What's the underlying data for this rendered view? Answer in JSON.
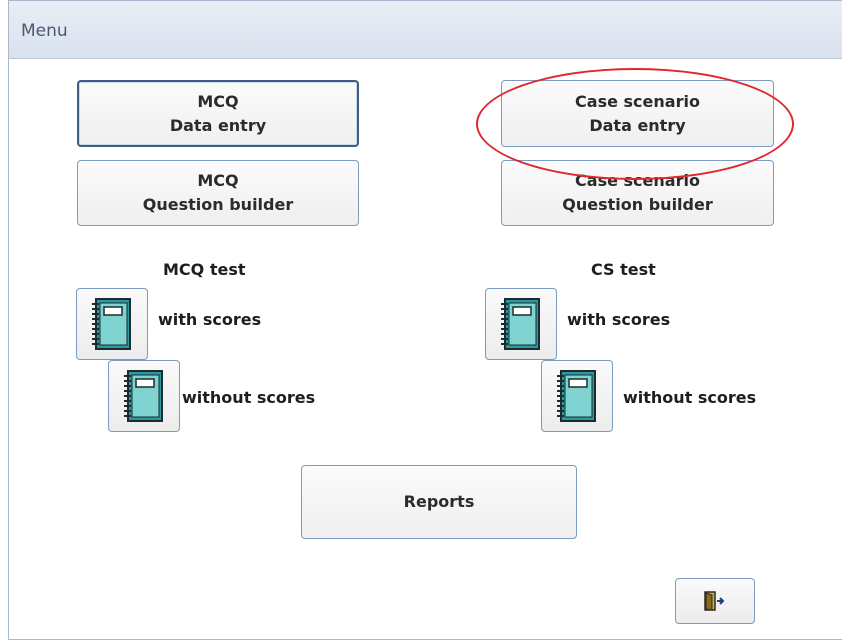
{
  "window": {
    "title": "Menu"
  },
  "mcq": {
    "data_entry": [
      "MCQ",
      "Data entry"
    ],
    "question_builder": [
      "MCQ",
      "Question builder"
    ],
    "test_heading": "MCQ test",
    "with_scores": "with scores",
    "without_scores": "without scores"
  },
  "cs": {
    "data_entry": [
      "Case scenario",
      "Data entry"
    ],
    "question_builder": [
      "Case scenario",
      "Question builder"
    ],
    "test_heading": "CS test",
    "with_scores": "with scores",
    "without_scores": "without scores"
  },
  "reports_label": "Reports",
  "colors": {
    "annotation_ellipse": "#e0262f",
    "notebook_teal": "#2a9aa0"
  },
  "icons": {
    "test_button": "notebook-icon",
    "exit_button": "exit-door-icon"
  }
}
